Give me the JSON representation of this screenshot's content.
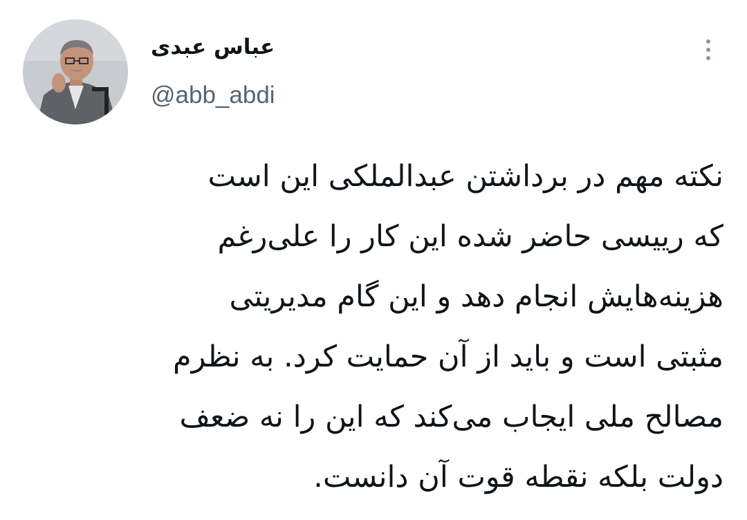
{
  "author": {
    "display_name": "عباس عبدی",
    "handle": "@abb_abdi",
    "avatar_icon": "profile-photo"
  },
  "tweet": {
    "lines": [
      "نکته مهم در برداشتن عبدالملکی این است",
      "که رییسی حاضر شده این کار را علی‌رغم",
      "هزینه‌هایش انجام دهد و این گام مدیریتی",
      "مثبتی است و باید از آن حمایت کرد. به نظرم",
      "مصالح ملی ایجاب می‌کند که این را نه ضعف",
      "دولت بلکه نقطه قوت آن دانست."
    ]
  },
  "menu": {
    "icon": "more-vertical-icon"
  },
  "colors": {
    "text": "#0f1419",
    "secondary": "#536471",
    "icon": "#8b98a5",
    "background": "#ffffff"
  }
}
